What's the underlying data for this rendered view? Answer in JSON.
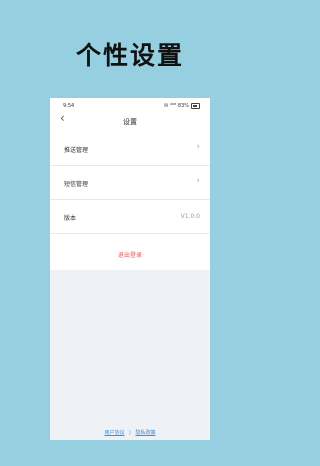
{
  "banner": {
    "title": "个性设置"
  },
  "status": {
    "time": "9:54",
    "indicators": "✉ ⁴⁶ᴳ 83%"
  },
  "navbar": {
    "back_icon": "‹",
    "title": "设置"
  },
  "settings": {
    "items": [
      {
        "label": "推送管理",
        "chevron": "›"
      },
      {
        "label": "短信管理",
        "chevron": "›"
      },
      {
        "label": "版本",
        "value": "V1.0.0"
      }
    ]
  },
  "logout_label": "退出登录",
  "footer": {
    "agreement": "用户协议",
    "separator": "|",
    "privacy": "隐私政策"
  }
}
